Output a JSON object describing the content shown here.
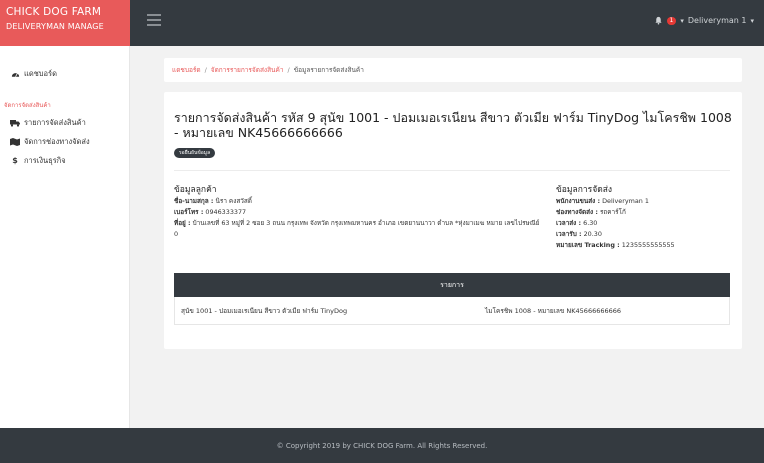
{
  "brand": {
    "title": "CHICK DOG FARM",
    "subtitle": "DELIVERYMAN MANAGE",
    "color": "#e85a5a"
  },
  "topbar": {
    "notification_count": "1",
    "user_label": "Deliveryman 1",
    "icons": {
      "menu": "hamburger-icon",
      "bell": "bell-icon",
      "user_caret": "caret-down-icon"
    }
  },
  "sidebar": {
    "dashboard": {
      "label": "แดชบอร์ด",
      "icon": "tachometer-icon"
    },
    "section_title": "จัดการจัดส่งสินค้า",
    "items": [
      {
        "label": "รายการจัดส่งสินค้า",
        "icon": "truck-icon"
      },
      {
        "label": "จัดการช่องทางจัดส่ง",
        "icon": "map-icon"
      },
      {
        "label": "การเงินธุรกิจ",
        "icon": "dollar-icon"
      }
    ]
  },
  "breadcrumb": {
    "items": [
      "แดชบอร์ด",
      "จัดการรายการจัดส่งสินค้า",
      "ข้อมูลรายการจัดส่งสินค้า"
    ],
    "separator": "/"
  },
  "card": {
    "title": "รายการจัดส่งสินค้า รหัส 9 สุนัข 1001 - ปอมเมอเรเนียน สีขาว ตัวเมีย ฟาร์ม TinyDog ไมโครชิพ 1008 - หมายเลข NK45666666666",
    "status_badge": "รอยืนยันข้อมูล",
    "customer": {
      "section_title": "ข้อมูลลูกค้า",
      "name_label": "ชื่อ-นามสกุล :",
      "name_value": "นิรา คงสวัสดิ์",
      "phone_label": "เบอร์โทร :",
      "phone_value": "0946333377",
      "address_label": "ที่อยู่ :",
      "address_value": "บ้านเลขที่ 63 หมู่ที่ 2 ซอย 3 ถนน กรุงเทพ จังหวัด กรุงเทพมหานคร อำเภอ เขตยานนาวา ตำบล *หุ่งมาเมฆ หมาย เลขไปรษณีย์ 0"
    },
    "shipping": {
      "section_title": "ข้อมูลการจัดส่ง",
      "staff_label": "พนักงานขนส่ง :",
      "staff_value": "Deliveryman 1",
      "channel_label": "ช่องทางจัดส่ง :",
      "channel_value": "รถคาร์โก้",
      "send_time_label": "เวลาส่ง :",
      "send_time_value": "6.30",
      "receive_time_label": "เวลารับ :",
      "receive_time_value": "20.30",
      "tracking_label": "หมายเลข Tracking :",
      "tracking_value": "1235555555555"
    },
    "table": {
      "header": "รายการ",
      "row": {
        "dog": "สุนัข 1001 - ปอมเมอเรเนียน สีขาว ตัวเมีย ฟาร์ม TinyDog",
        "chip": "ไมโครชิพ 1008 - หมายเลข NK45666666666"
      }
    }
  },
  "footer": {
    "text": "© Copyright 2019 by CHICK DOG Farm. All Rights Reserved."
  }
}
